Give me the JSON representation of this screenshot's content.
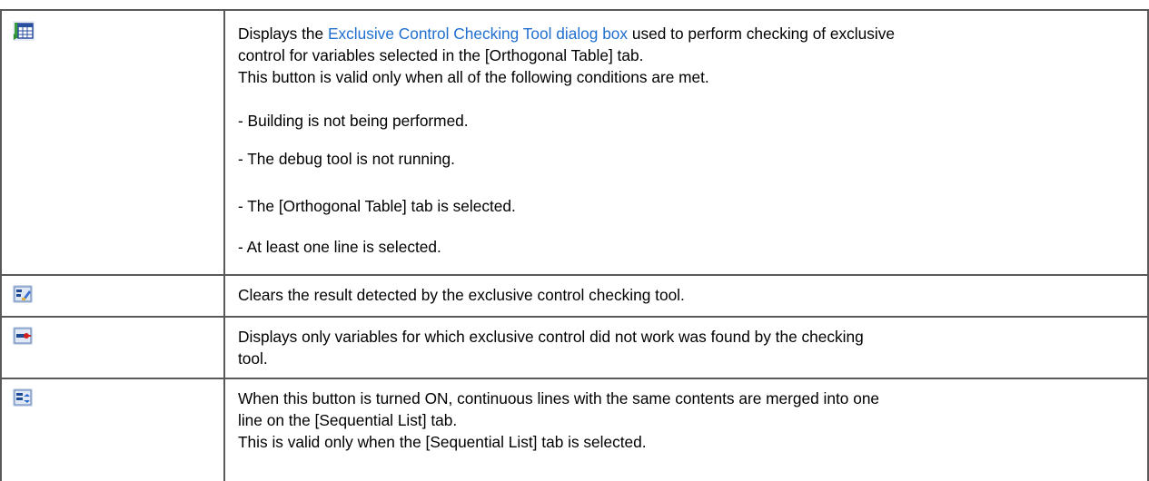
{
  "rows": [
    {
      "icon": "exclusive-control-check-icon",
      "desc_link": "Exclusive Control Checking Tool dialog box",
      "desc_prefix": "Displays the ",
      "desc_suffix": " used to perform checking of exclusive",
      "desc_line2": "control for variables selected in the [Orthogonal Table] tab.",
      "desc_line3": "This button is valid only when all of the following conditions are met.",
      "conditions": [
        "- Building is not being performed.",
        "- The debug tool is not running.",
        "- The [Orthogonal Table] tab is selected.",
        "- At least one line is selected."
      ]
    },
    {
      "icon": "clear-result-icon",
      "desc_line1": "Clears the result detected by the exclusive control checking tool."
    },
    {
      "icon": "filter-variables-icon",
      "desc_line1": "Displays only variables for which exclusive control did not work was found by the checking",
      "desc_line2": "tool."
    },
    {
      "icon": "merge-lines-icon",
      "desc_line1": "When this button is turned ON, continuous lines with the same contents are merged into one",
      "desc_line2": "line on the [Sequential List] tab.",
      "desc_line3": "This is valid only when the [Sequential List] tab is selected."
    }
  ]
}
